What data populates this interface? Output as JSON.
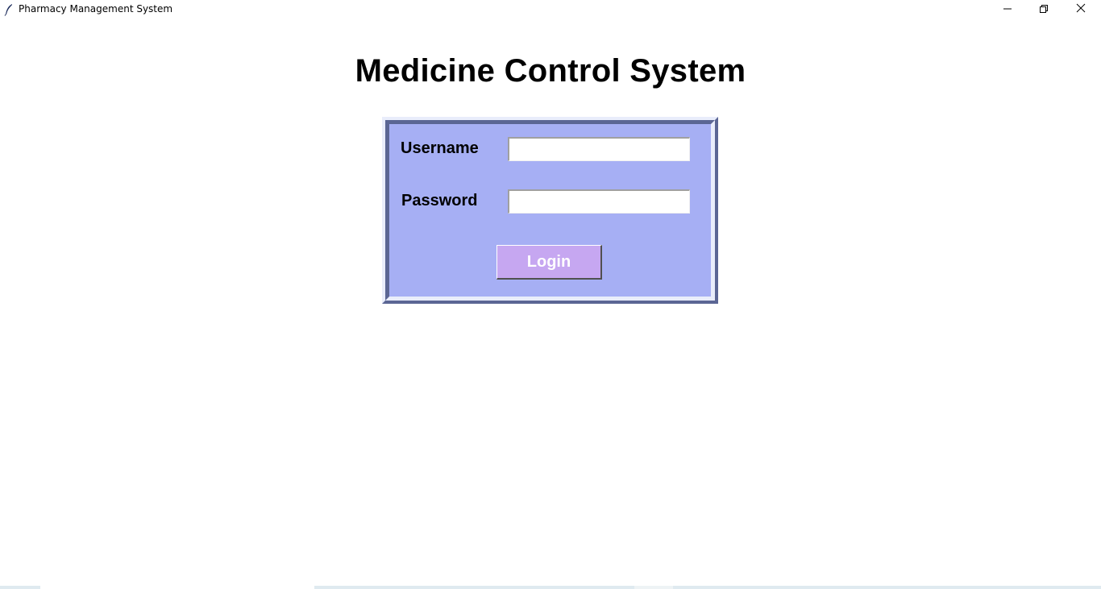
{
  "window": {
    "title": "Pharmacy Management System",
    "icon": "feather-icon",
    "controls": {
      "minimize": "minimize-icon",
      "maximize": "restore-icon",
      "close": "close-icon"
    }
  },
  "main": {
    "heading": "Medicine Control System"
  },
  "login_form": {
    "username_label": "Username",
    "username_value": "",
    "password_label": "Password",
    "password_value": "",
    "login_button": "Login"
  },
  "colors": {
    "panel_face": "#a6aff4",
    "panel_shadow": "#5b6694",
    "panel_highlight": "#e9edfb",
    "button_bg": "#c6a7f1",
    "button_text": "#ffffff"
  }
}
